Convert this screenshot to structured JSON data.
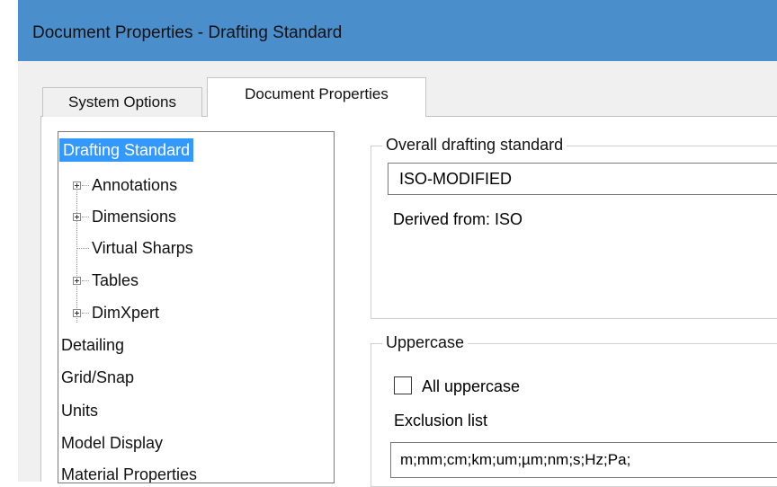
{
  "window": {
    "title": "Document Properties - Drafting Standard"
  },
  "tabs": [
    {
      "label": "System Options",
      "active": false
    },
    {
      "label": "Document Properties",
      "active": true
    }
  ],
  "tree": {
    "items": [
      {
        "label": "Drafting Standard",
        "selected": true,
        "expandable": false
      },
      {
        "label": "Annotations",
        "expandable": true
      },
      {
        "label": "Dimensions",
        "expandable": true
      },
      {
        "label": "Virtual Sharps",
        "expandable": false
      },
      {
        "label": "Tables",
        "expandable": true
      },
      {
        "label": "DimXpert",
        "expandable": true
      },
      {
        "label": "Detailing"
      },
      {
        "label": "Grid/Snap"
      },
      {
        "label": "Units"
      },
      {
        "label": "Model Display"
      },
      {
        "label": "Material Properties"
      }
    ]
  },
  "overall_standard": {
    "group_title": "Overall drafting standard",
    "value": "ISO-MODIFIED",
    "derived_from": "Derived from: ISO"
  },
  "uppercase": {
    "group_title": "Uppercase",
    "all_uppercase_label": "All uppercase",
    "all_uppercase_checked": false,
    "exclusion_label": "Exclusion list",
    "exclusion_value": "m;mm;cm;km;um;µm;nm;s;Hz;Pa;"
  },
  "colors": {
    "title_bar": "#4a8fcc",
    "selection": "#3399ff"
  }
}
